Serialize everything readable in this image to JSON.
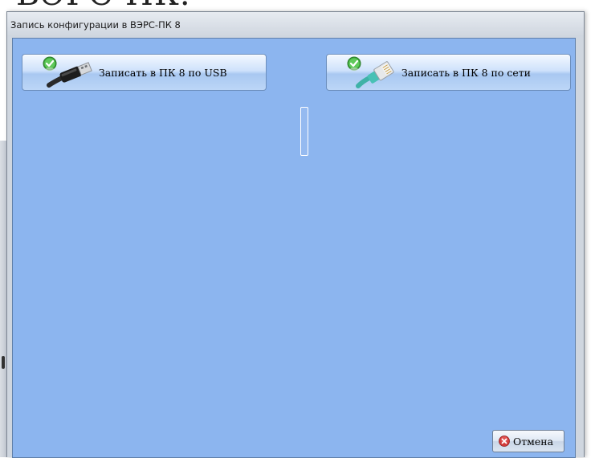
{
  "background": {
    "partial_text": "ВЭРС-ПК."
  },
  "window": {
    "title": "Запись конфигурации в ВЭРС-ПК 8",
    "client_color": "#8cb5ef"
  },
  "buttons": {
    "usb": {
      "label": "Записать в ПК 8 по USB",
      "icon": "usb-cable-icon"
    },
    "network": {
      "label": "Записать в ПК 8 по сети",
      "icon": "network-cable-icon"
    },
    "cancel": {
      "label": "Отмена",
      "icon": "cancel-icon"
    }
  }
}
